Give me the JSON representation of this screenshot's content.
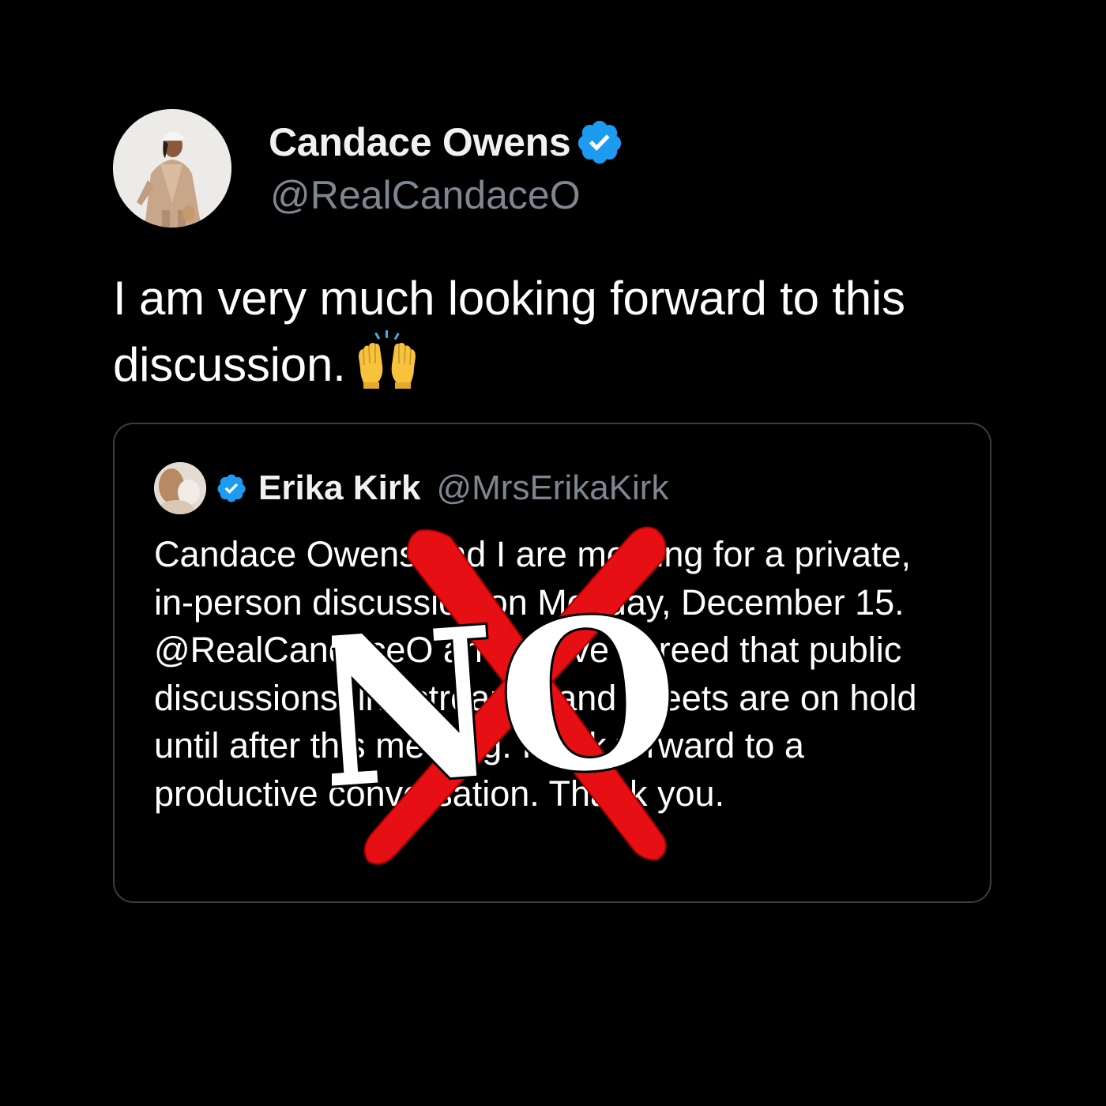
{
  "tweet": {
    "author_name": "Candace Owens",
    "author_handle": "@RealCandaceO",
    "text": "I am very much looking forward to this discussion.",
    "emoji_icon": "raised-hands-icon",
    "verified_color": "#1d9bf0"
  },
  "quote": {
    "author_name": "Erika Kirk",
    "author_handle": "@MrsErikaKirk",
    "text": "Candace Owens and I are meeting for a private, in-person discussion on Monday, December 15. @RealCandaceO and I have agreed that public discussions, livestreams, and tweets are on hold until after this meeting. I look forward to a productive conversation. Thank you.",
    "verified_color": "#1d9bf0"
  },
  "overlay": {
    "label": "NO",
    "cross_color": "#e60f13",
    "letter_fill": "#ffffff",
    "letter_outline": "#000000"
  }
}
